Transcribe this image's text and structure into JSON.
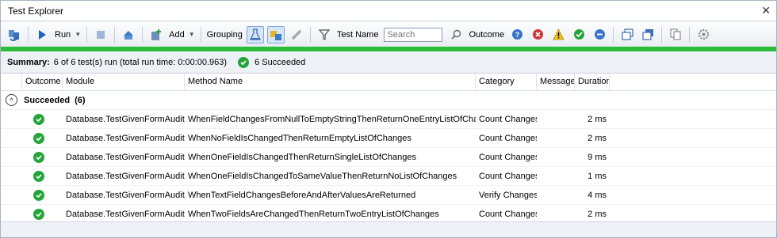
{
  "window": {
    "title": "Test Explorer",
    "close_glyph": "✕"
  },
  "toolbar": {
    "run_label": "Run",
    "add_label": "Add",
    "grouping_label": "Grouping",
    "test_name_label": "Test Name",
    "search_placeholder": "Search",
    "outcome_label": "Outcome"
  },
  "summary": {
    "label": "Summary:",
    "text": "6 of 6 test(s) run (total run time: 0:00:00.963)",
    "succeeded_text": "6 Succeeded"
  },
  "progress": {
    "value": 1.0,
    "color": "#2dbb3b"
  },
  "columns": [
    "Outcome",
    "Module",
    "Method Name",
    "Category",
    "Message",
    "Duration"
  ],
  "group": {
    "expander": "^",
    "label": "Succeeded",
    "count": "(6)"
  },
  "rows": [
    {
      "outcome": "passed",
      "module": "Database.TestGivenFormAuditor",
      "method": "WhenFieldChangesFromNullToEmptyStringThenReturnOneEntryListOfChanges",
      "category": "Count Changes",
      "message": "",
      "duration": "2 ms"
    },
    {
      "outcome": "passed",
      "module": "Database.TestGivenFormAuditor",
      "method": "WhenNoFieldIsChangedThenReturnEmptyListOfChanges",
      "category": "Count Changes",
      "message": "",
      "duration": "2 ms"
    },
    {
      "outcome": "passed",
      "module": "Database.TestGivenFormAuditor",
      "method": "WhenOneFieldIsChangedThenReturnSingleListOfChanges",
      "category": "Count Changes",
      "message": "",
      "duration": "9 ms"
    },
    {
      "outcome": "passed",
      "module": "Database.TestGivenFormAuditor",
      "method": "WhenOneFieldIsChangedToSameValueThenReturnNoListOfChanges",
      "category": "Count Changes",
      "message": "",
      "duration": "1 ms"
    },
    {
      "outcome": "passed",
      "module": "Database.TestGivenFormAuditor",
      "method": "WhenTextFieldChangesBeforeAndAfterValuesAreReturned",
      "category": "Verify Changes",
      "message": "",
      "duration": "4 ms"
    },
    {
      "outcome": "passed",
      "module": "Database.TestGivenFormAuditor",
      "method": "WhenTwoFieldsAreChangedThenReturnTwoEntryListOfChanges",
      "category": "Count Changes",
      "message": "",
      "duration": "2 ms"
    }
  ],
  "colors": {
    "passed": "#24a53a",
    "accent": "#7fa7d9"
  }
}
